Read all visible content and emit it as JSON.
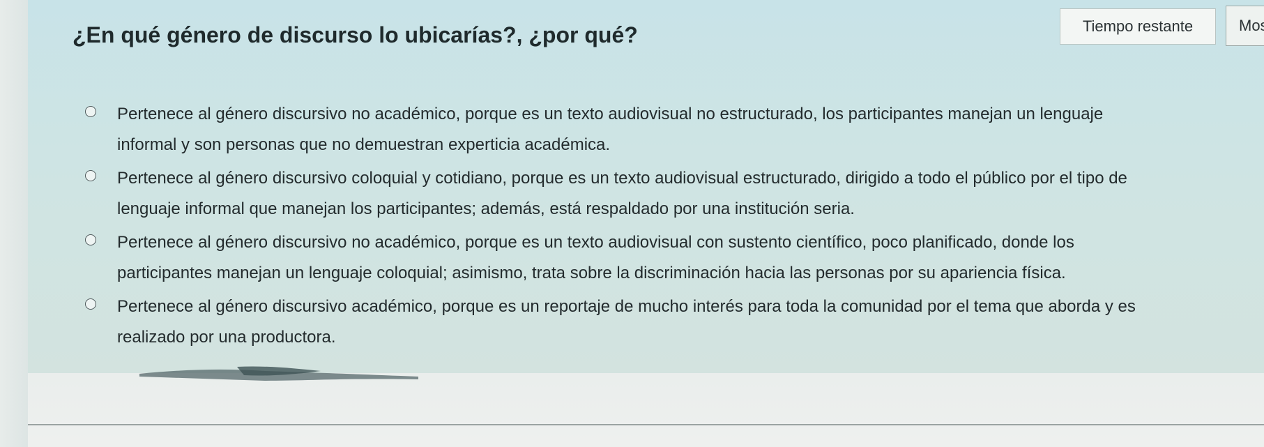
{
  "question": {
    "title": "¿En qué género de discurso lo ubicarías?, ¿por qué?"
  },
  "header": {
    "timer_label": "Tiempo restante",
    "show_button_label": "Mostra"
  },
  "options": [
    {
      "line1": "Pertenece al género discursivo no académico, porque es un texto audiovisual no estructurado, los participantes manejan un lenguaje",
      "line2": "informal y son personas que no demuestran experticia académica."
    },
    {
      "line1": "Pertenece al género discursivo coloquial y cotidiano, porque es un texto audiovisual estructurado, dirigido a todo el público por el tipo de",
      "line2": "lenguaje informal que manejan los participantes; además, está respaldado por una institución seria."
    },
    {
      "line1": "Pertenece al género discursivo no académico, porque es un texto audiovisual con sustento científico, poco planificado, donde los",
      "line2": "participantes manejan un lenguaje coloquial; asimismo, trata sobre la discriminación hacia las personas por su apariencia física."
    },
    {
      "line1": "Pertenece al género discursivo académico, porque es un reportaje de mucho interés para toda la comunidad por el tema que aborda y es",
      "line2": "realizado por una productora."
    }
  ],
  "colors": {
    "panel": "#cfe4e3",
    "text": "#232b2d"
  }
}
